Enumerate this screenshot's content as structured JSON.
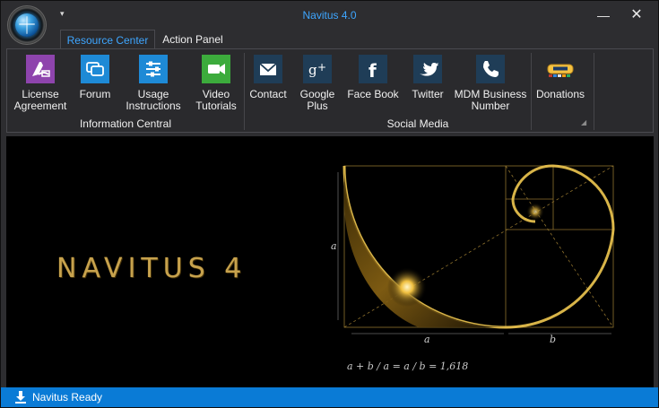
{
  "window": {
    "title": "Navitus 4.0",
    "quick_access_glyph": "▾",
    "minimize_glyph": "—",
    "close_glyph": "✕"
  },
  "tabs": [
    {
      "label": "Resource Center",
      "active": true
    },
    {
      "label": "Action Panel",
      "active": false
    }
  ],
  "ribbon": {
    "groups": [
      {
        "label": "Information Central",
        "buttons": [
          {
            "label_line1": "License",
            "label_line2": "Agreement",
            "icon": "license-icon",
            "color": "#8e44ad"
          },
          {
            "label_line1": "Forum",
            "label_line2": "",
            "icon": "chat-bubbles-icon",
            "color": "#1e8ad6"
          },
          {
            "label_line1": "Usage",
            "label_line2": "Instructions",
            "icon": "sliders-icon",
            "color": "#1e8ad6"
          },
          {
            "label_line1": "Video",
            "label_line2": "Tutorials",
            "icon": "video-camera-icon",
            "color": "#3cab3c"
          }
        ]
      },
      {
        "label": "Social Media",
        "buttons": [
          {
            "label_line1": "Contact",
            "label_line2": "",
            "icon": "envelope-icon",
            "color": "#1f3d57"
          },
          {
            "label_line1": "Google",
            "label_line2": "Plus",
            "icon": "google-plus-icon",
            "color": "#1f3d57"
          },
          {
            "label_line1": "Face Book",
            "label_line2": "",
            "icon": "facebook-icon",
            "color": "#1f3d57"
          },
          {
            "label_line1": "Twitter",
            "label_line2": "",
            "icon": "twitter-icon",
            "color": "#1f3d57"
          },
          {
            "label_line1": "MDM Business",
            "label_line2": "Number",
            "icon": "phone-icon",
            "color": "#1f3d57"
          },
          {
            "label_line1": "Donations",
            "label_line2": "",
            "icon": "paypal-donate-icon",
            "color": "#f5c242"
          }
        ]
      }
    ]
  },
  "content": {
    "logo_text": "NAVITUS 4",
    "formula_text": "a + b / a = a / b = 1,618",
    "label_a_left": "a",
    "label_a_bottom": "a",
    "label_b_bottom": "b"
  },
  "status": {
    "text": "Navitus Ready",
    "icon": "download-icon"
  },
  "colors": {
    "accent": "#3ea6ff",
    "status_bar": "#0a7bd6",
    "gold": "#c7a24d"
  }
}
